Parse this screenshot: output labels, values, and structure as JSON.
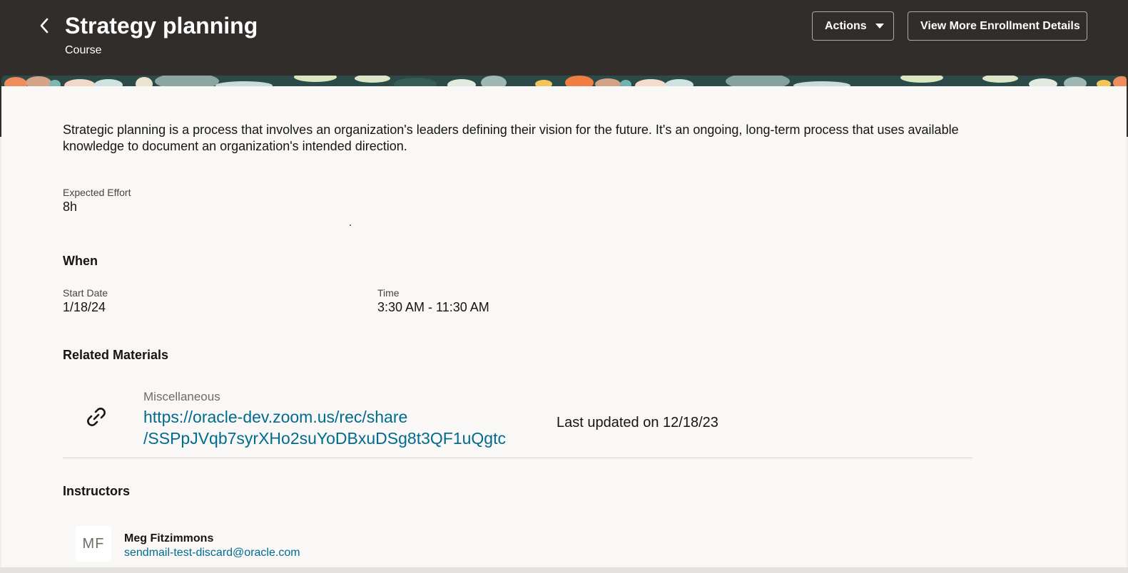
{
  "header": {
    "title": "Strategy planning",
    "subtitle": "Course",
    "actions_label": "Actions",
    "enrollment_label": "View More Enrollment Details"
  },
  "description": "Strategic planning is a process that involves an organization's leaders defining their vision for the future. It's an ongoing, long-term process that uses available knowledge to document an organization's intended direction.",
  "effort": {
    "label": "Expected Effort",
    "value": "8h"
  },
  "when": {
    "title": "When",
    "start_date_label": "Start Date",
    "start_date_value": "1/18/24",
    "time_label": "Time",
    "time_value": "3:30 AM - 11:30 AM"
  },
  "related_materials": {
    "title": "Related Materials",
    "items": [
      {
        "category": "Miscellaneous",
        "link_line1": "https://oracle-dev.zoom.us/rec/share",
        "link_line2": "/SSPpJVqb7syrXHo2suYoDBxuDSg8t3QF1uQgtc",
        "updated": "Last updated on 12/18/23",
        "icon": "link-icon"
      }
    ]
  },
  "instructors": {
    "title": "Instructors",
    "items": [
      {
        "initials": "MF",
        "name": "Meg Fitzimmons",
        "email": "sendmail-test-discard@oracle.com"
      }
    ]
  },
  "colors": {
    "header_bg": "#312d2a",
    "page_bg": "#f9f8f6",
    "link": "#006b8f",
    "text": "#161513"
  }
}
